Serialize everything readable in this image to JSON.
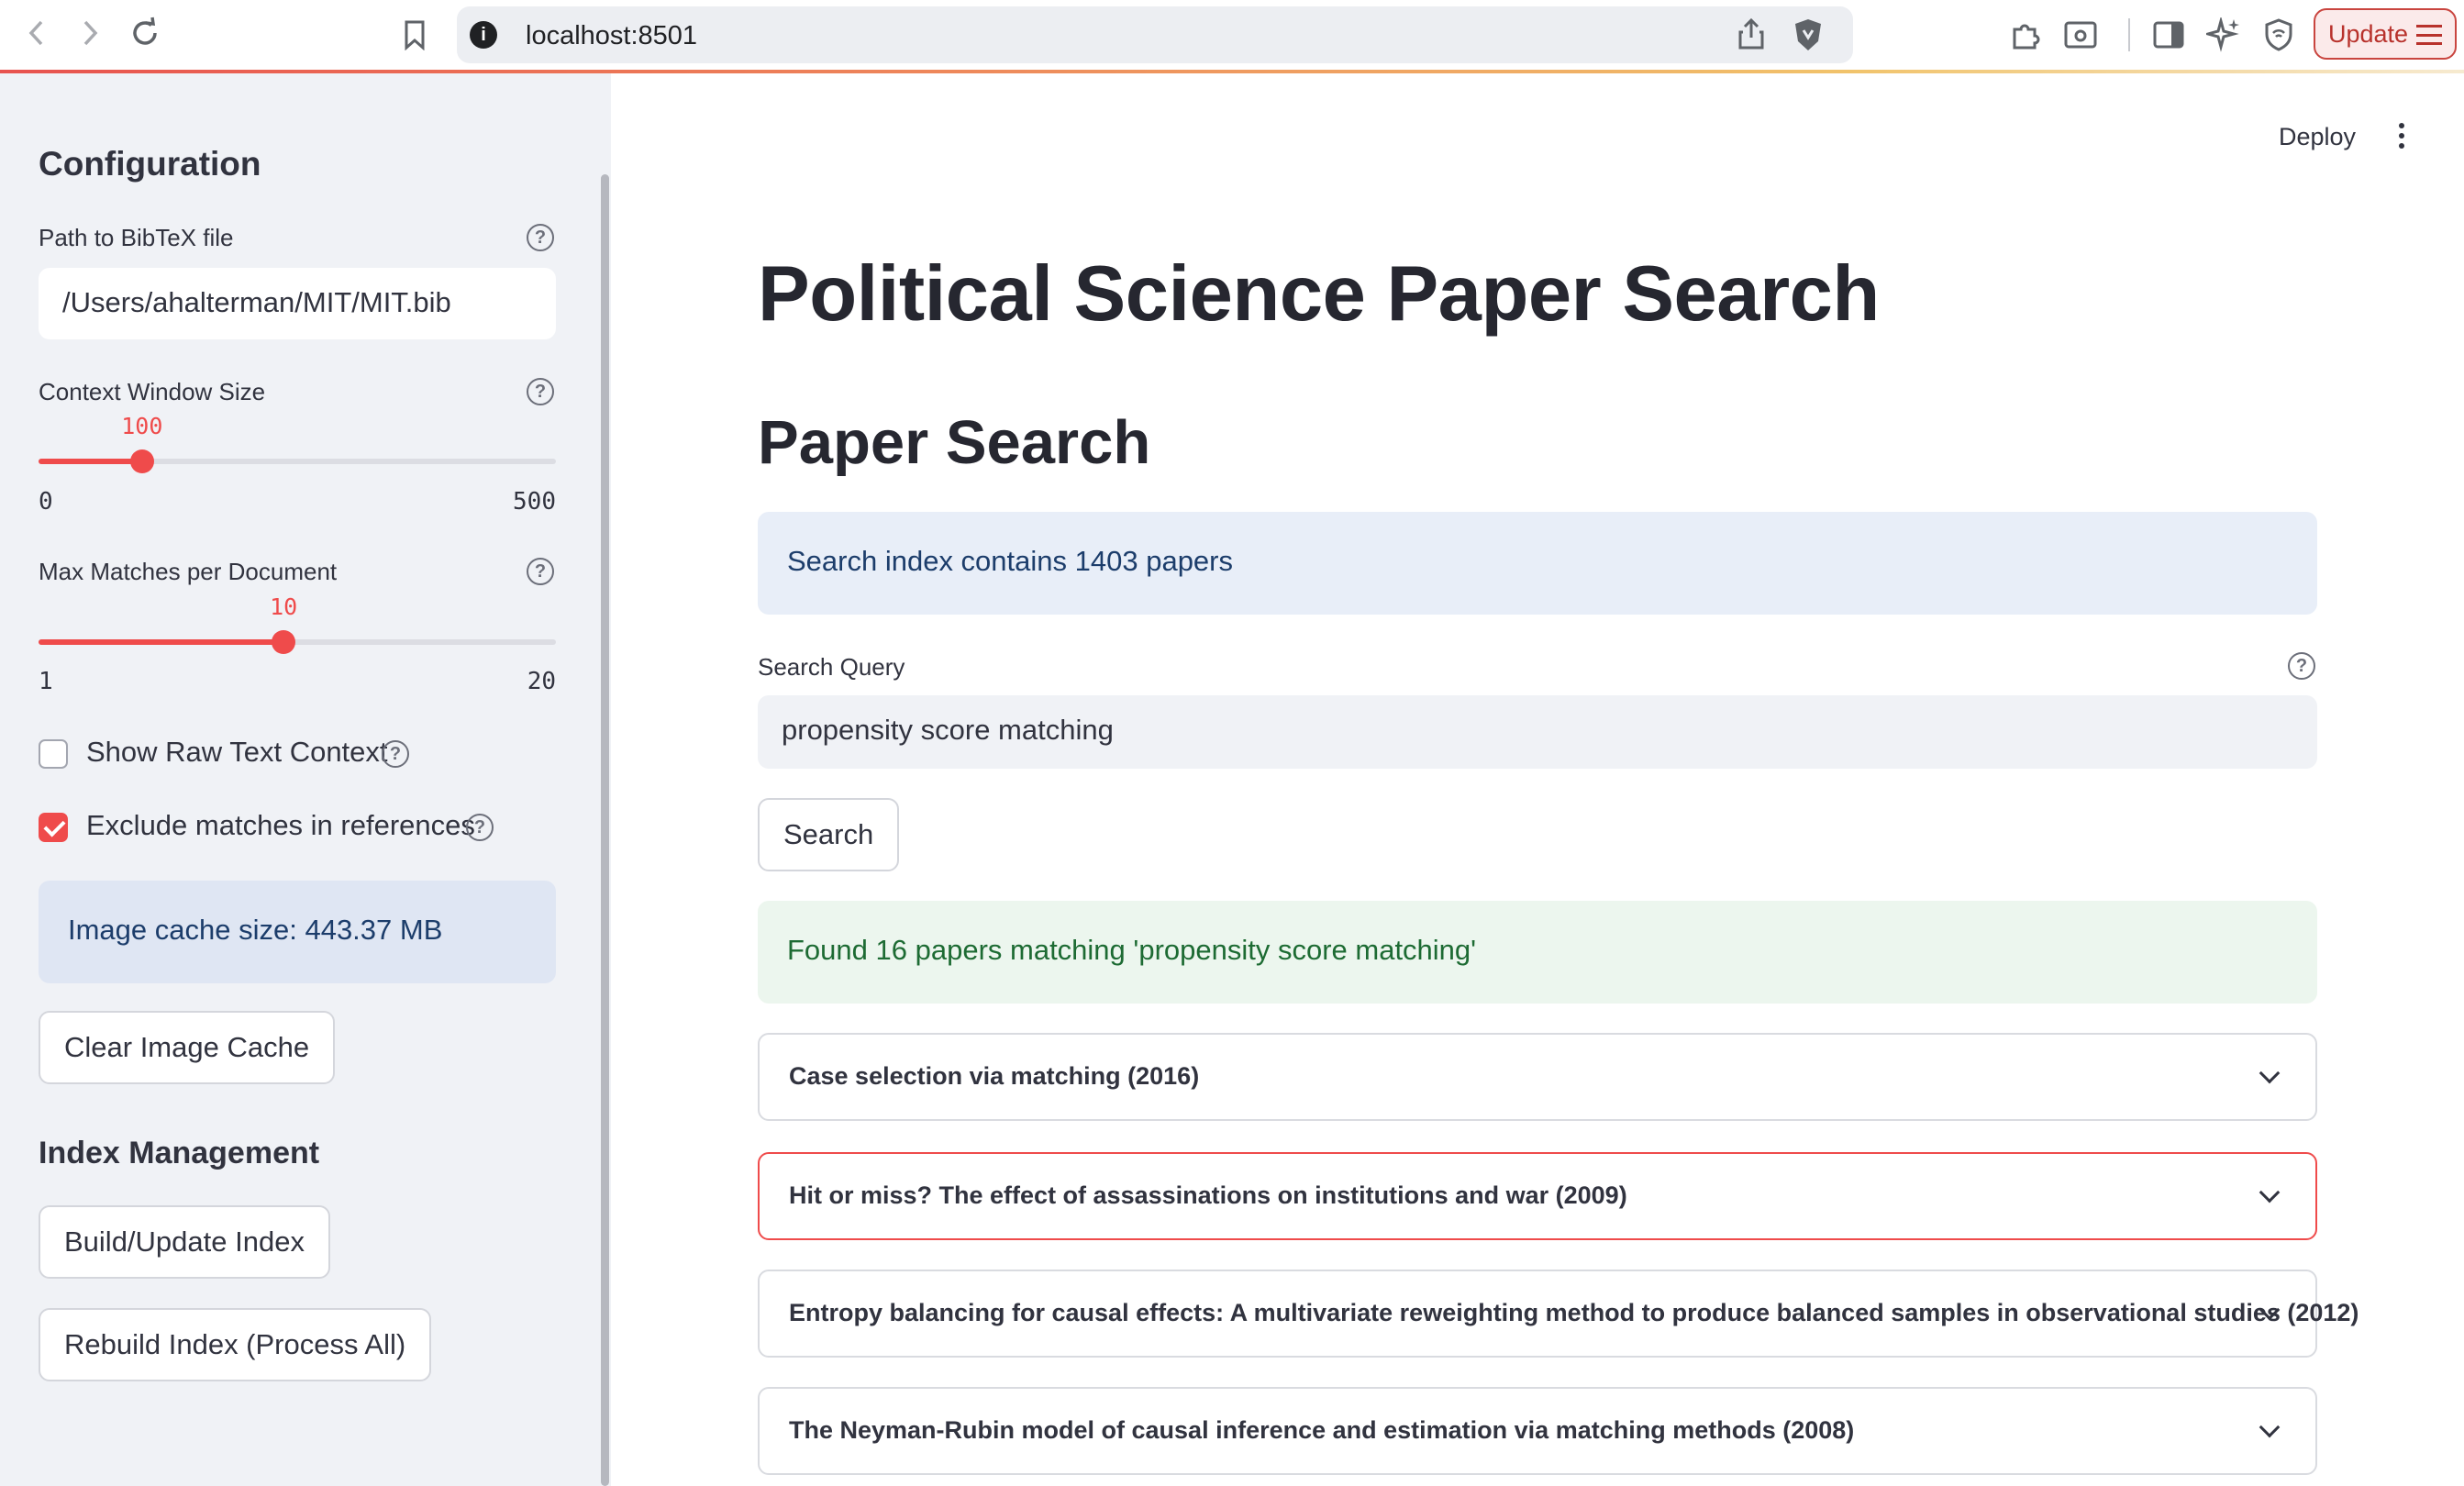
{
  "browser": {
    "url": "localhost:8501",
    "update_label": "Update"
  },
  "sidebar": {
    "title": "Configuration",
    "bibtex": {
      "label": "Path to BibTeX file",
      "value": "/Users/ahalterman/MIT/MIT.bib"
    },
    "context_window": {
      "label": "Context Window Size",
      "value": "100",
      "min": "0",
      "max": "500",
      "fraction": 0.2
    },
    "max_matches": {
      "label": "Max Matches per Document",
      "value": "10",
      "min": "1",
      "max": "20",
      "fraction": 0.4737
    },
    "show_raw": {
      "label": "Show Raw Text Context",
      "checked": false
    },
    "exclude_refs": {
      "label": "Exclude matches in references",
      "checked": true
    },
    "cache_info": "Image cache size: 443.37 MB",
    "clear_cache_label": "Clear Image Cache",
    "index_title": "Index Management",
    "build_label": "Build/Update Index",
    "rebuild_label": "Rebuild Index (Process All)"
  },
  "header": {
    "deploy_label": "Deploy"
  },
  "main": {
    "title": "Political Science Paper Search",
    "subtitle": "Paper Search",
    "index_info": "Search index contains 1403 papers",
    "query_label": "Search Query",
    "query_value": "propensity score matching",
    "search_label": "Search",
    "result_info": "Found 16 papers matching 'propensity score matching'",
    "results": [
      {
        "title": "Case selection via matching (2016)"
      },
      {
        "title": "Hit or miss? The effect of assassinations on institutions and war (2009)"
      },
      {
        "title": "Entropy balancing for causal effects: A multivariate reweighting method to produce balanced samples in observational studies (2012)"
      },
      {
        "title": "The Neyman-Rubin model of causal inference and estimation via matching methods (2008)"
      }
    ]
  },
  "colors": {
    "accent": "#ef4b4b",
    "sidebar_bg": "#f0f2f6",
    "info_text": "#1c3d6b",
    "success_text": "#1d6b33"
  }
}
